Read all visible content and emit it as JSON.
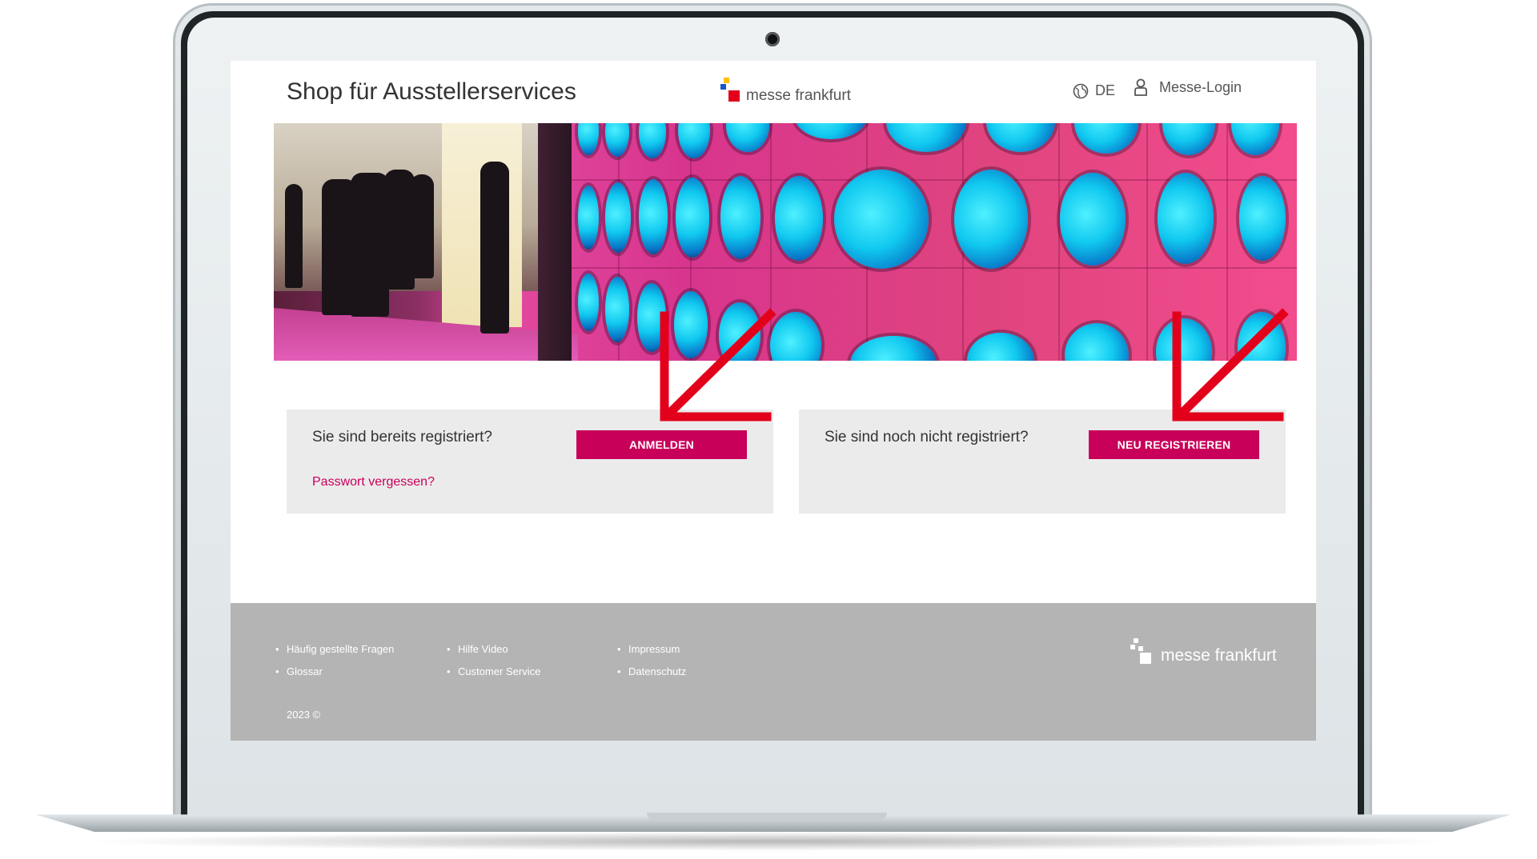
{
  "header": {
    "title": "Shop für Ausstellerservices",
    "logo_text": "messe frankfurt",
    "language": "DE",
    "login_label": "Messe-Login"
  },
  "cards": {
    "registered": {
      "question": "Sie sind bereits registriert?",
      "button_label": "ANMELDEN",
      "forgot_password_link": "Passwort vergessen?"
    },
    "not_registered": {
      "question": "Sie sind noch nicht registriert?",
      "button_label": "NEU REGISTRIEREN"
    }
  },
  "footer": {
    "col1": [
      "Häufig gestellte Fragen",
      "Glossar"
    ],
    "col2": [
      "Hilfe Video",
      "Customer Service"
    ],
    "col3": [
      "Impressum",
      "Datenschutz"
    ],
    "copyright": "2023 ©",
    "logo_text": "messe frankfurt"
  },
  "colors": {
    "accent": "#c8005a",
    "footer_bg": "#b4b4b4",
    "card_bg": "#ebebeb",
    "annotation_arrow": "#e3001b"
  }
}
